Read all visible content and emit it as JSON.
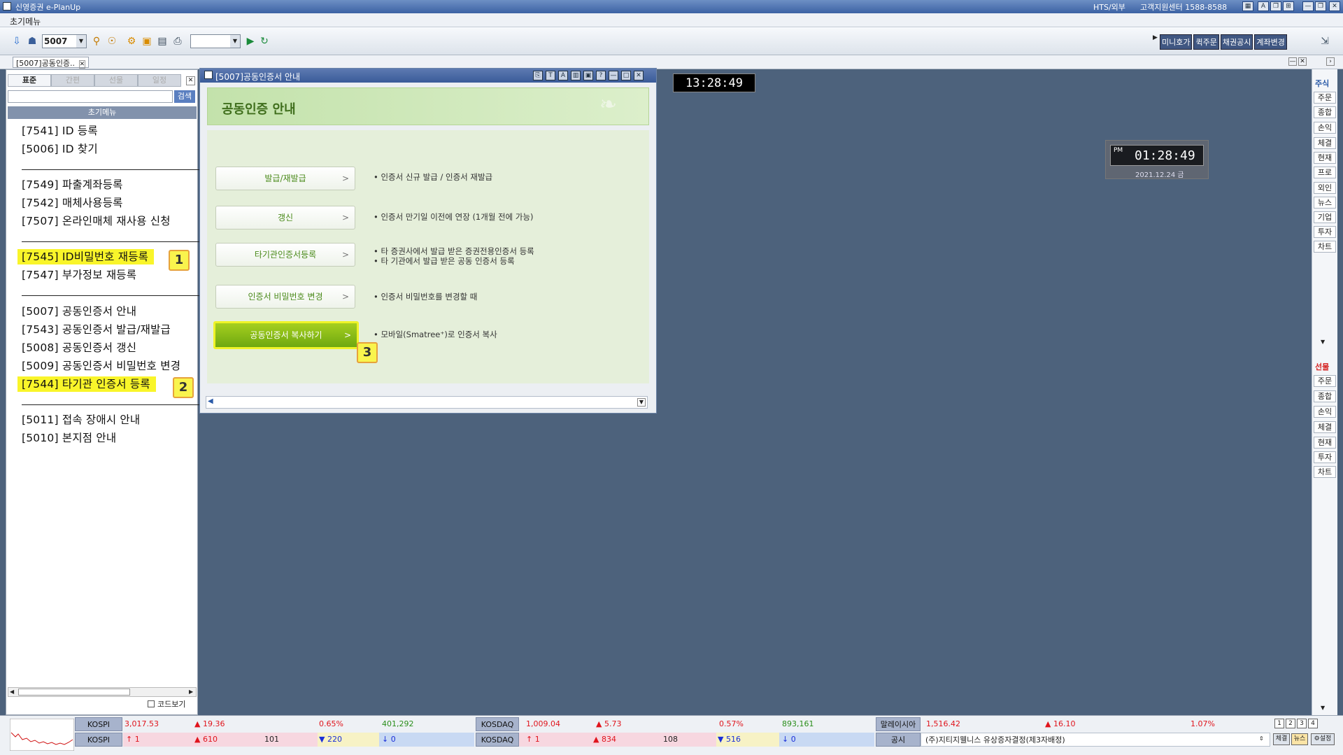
{
  "app": {
    "title": "신영증권 e-PlanUp",
    "mode": "HTS/외부",
    "support": "고객지원센터 1588-8588"
  },
  "menubar": {
    "label": "초기메뉴"
  },
  "toolbar": {
    "screen_no": "5007",
    "quick_buttons": [
      "미니호가",
      "퀵주문",
      "채권공시",
      "계좌변경"
    ]
  },
  "tabrow": {
    "open_tab": "[5007]공동인증.."
  },
  "left": {
    "tabs": [
      "표준",
      "간편",
      "선물",
      "일정"
    ],
    "search_btn": "검색",
    "menu_header": "초기메뉴",
    "items": [
      "[7541] ID 등록",
      "[5006] ID 찾기",
      "[7549] 파출계좌등록",
      "[7542] 매체사용등록",
      "[7507] 온라인매체 재사용 신청",
      "[7545] ID비밀번호 재등록",
      "[7547] 부가정보 재등록",
      "[5007] 공동인증서 안내",
      "[7543] 공동인증서 발급/재발급",
      "[5008] 공동인증서 갱신",
      "[5009] 공동인증서 비밀번호 변경",
      "[7544] 타기관 인증서 등록",
      "[5011] 접속 장애시 안내",
      "[5010] 본지점 안내"
    ],
    "badges": [
      "1",
      "2"
    ],
    "code_view": "코드보기"
  },
  "dialog": {
    "title": "[5007]공동인증서 안내",
    "heading": "공동인증 안내",
    "options": [
      {
        "label": "발급/재발급",
        "desc": [
          "• 인증서 신규 발급 / 인증서 재발급"
        ]
      },
      {
        "label": "갱신",
        "desc": [
          "• 인증서 만기일 이전에 연장 (1개월 전에 가능)"
        ]
      },
      {
        "label": "타기관인증서등록",
        "desc": [
          "• 타 증권사에서 발급 받은 증권전용인증서 등록",
          "• 타 기관에서 발급 받은 공동 인증서 등록"
        ]
      },
      {
        "label": "인증서 비밀번호 변경",
        "desc": [
          "• 인증서 비밀번호를 변경할 때"
        ]
      },
      {
        "label": "공동인증서 복사하기",
        "desc": [
          "• 모바일(Smatree⁺)로 인증서 복사"
        ]
      }
    ],
    "badge": "3",
    "chevron": ">"
  },
  "clock1": "13:28:49",
  "clock2": {
    "ampm": "PM",
    "time": "01:28:49",
    "date": "2021.12.24 금"
  },
  "rightbar": {
    "top_header": "주식",
    "top": [
      "주문",
      "종합",
      "손익",
      "체결",
      "현재",
      "프로",
      "외인",
      "뉴스",
      "기업",
      "투자",
      "차트"
    ],
    "bottom_header": "선물",
    "bottom": [
      "주문",
      "종합",
      "손익",
      "체결",
      "현재",
      "투자",
      "차트"
    ]
  },
  "ticker": {
    "row1": {
      "kospi": {
        "label": "KOSPI",
        "value": "3,017.53",
        "change": "▲ 19.36",
        "pct": "0.65%",
        "volume": "401,292"
      },
      "kosdaq": {
        "label": "KOSDAQ",
        "value": "1,009.04",
        "change": "▲ 5.73",
        "pct": "0.57%",
        "volume": "893,161"
      },
      "malaysia": {
        "label": "말레이시아",
        "value": "1,516.42",
        "change": "▲ 16.10",
        "pct": "1.07%"
      }
    },
    "row2": {
      "kospi": {
        "label": "KOSPI",
        "up_limit": "↑ 1",
        "up": "▲ 610",
        "flat": "101",
        "down": "▼ 220",
        "down_limit": "↓ 0"
      },
      "kosdaq": {
        "label": "KOSDAQ",
        "up_limit": "↑ 1",
        "up": "▲ 834",
        "flat": "108",
        "down": "▼ 516",
        "down_limit": "↓ 0"
      },
      "notice_label": "공시",
      "notice": "(주)지티지웰니스 유상증자결정(제3자배정)"
    },
    "pages": [
      "1",
      "2",
      "3",
      "4"
    ],
    "buttons": [
      "체결",
      "뉴스",
      "설정"
    ]
  }
}
